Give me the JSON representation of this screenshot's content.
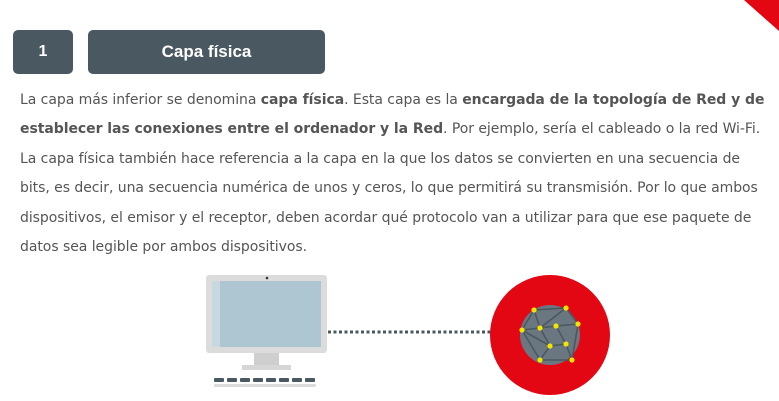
{
  "header": {
    "step_number": "1",
    "title": "Capa física"
  },
  "content": {
    "p1_a": "La capa más inferior se denomina ",
    "p1_b": "capa física",
    "p1_c": ". Esta capa es la ",
    "p1_d": "encargada de la topología de Red y de establecer las conexiones entre el ordenador y la Red",
    "p1_e": ". Por ejemplo, sería el cableado o la red Wi-Fi.",
    "p2": "La capa física también hace referencia a la capa en la que los datos se convierten en una secuencia de bits, es decir, una secuencia numérica de unos y ceros, lo que permitirá su transmisión. Por lo que ambos dispositivos, el emisor y el receptor, deben acordar qué protocolo van a utilizar para que ese paquete de datos sea legible por ambos dispositivos."
  },
  "colors": {
    "accent_red": "#e30613",
    "header_bg": "#4a5862",
    "text": "#555555"
  },
  "illustration": {
    "left_icon": "desktop-computer-icon",
    "right_icon": "network-globe-icon"
  }
}
